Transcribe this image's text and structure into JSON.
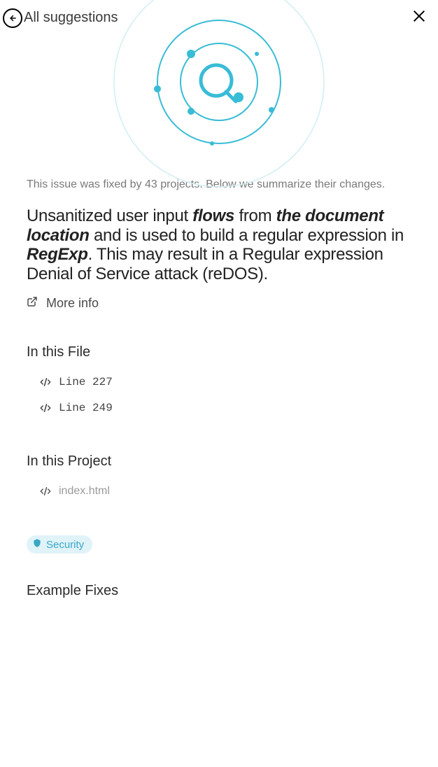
{
  "header": {
    "back_label": "All suggestions"
  },
  "fixed_info": "This issue was fixed by 43 projects. Below we summarize their changes.",
  "description": {
    "p1": "Unsanitized user input ",
    "e1": "flows",
    "p2": " from ",
    "e2": "the document location",
    "p3": " and is used to build a regular expression in ",
    "e3": "RegExp",
    "p4": ". This may result in a Regular expression Denial of Service attack (reDOS)."
  },
  "more_info_label": "More info",
  "sections": {
    "in_file_title": "In this File",
    "file_lines": [
      "Line 227",
      "Line 249"
    ],
    "in_project_title": "In this Project",
    "project_files": [
      "index.html"
    ],
    "example_fixes_title": "Example Fixes"
  },
  "badge": {
    "security_label": "Security"
  }
}
